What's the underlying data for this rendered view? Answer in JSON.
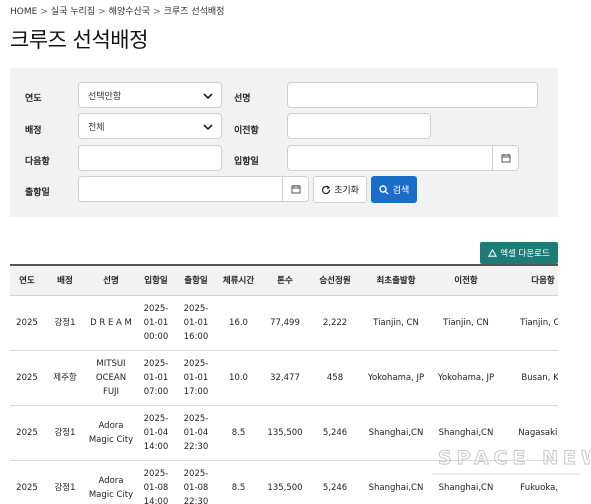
{
  "breadcrumb": [
    "HOME",
    "실국 누리집",
    "해양수산국",
    "크루즈 선석배정"
  ],
  "page_title": "크루즈 선석배정",
  "search": {
    "year_label": "연도",
    "year_value": "선택안함",
    "ship_label": "선명",
    "ship_value": "",
    "berth_label": "배정",
    "berth_value": "전체",
    "prev_port_label": "이전항",
    "prev_port_value": "",
    "next_port_label": "다음항",
    "next_port_value": "",
    "arrival_label": "입항일",
    "arrival_value": "",
    "departure_label": "출항일",
    "departure_value": "",
    "reset_label": "초기화",
    "search_label": "검색"
  },
  "excel_label": "엑셀 다운로드",
  "table": {
    "headers": [
      "연도",
      "배정",
      "선명",
      "입항일",
      "출항일",
      "체류시간",
      "톤수",
      "승선정원",
      "최초출발항",
      "이전항",
      "다음항"
    ],
    "rows": [
      [
        "2025",
        "강정1",
        "D R E A M",
        "2025-01-01 00:00",
        "2025-01-01 16:00",
        "16.0",
        "77,499",
        "2,222",
        "Tianjin, CN",
        "Tianjin, CN",
        "Tianjin, CN"
      ],
      [
        "2025",
        "제주항",
        "MITSUI OCEAN FUJI",
        "2025-01-01 07:00",
        "2025-01-01 17:00",
        "10.0",
        "32,477",
        "458",
        "Yokohama, JP",
        "Yokohama, JP",
        "Busan, KR"
      ],
      [
        "2025",
        "강정1",
        "Adora Magic City",
        "2025-01-04 14:00",
        "2025-01-04 22:30",
        "8.5",
        "135,500",
        "5,246",
        "Shanghai,CN",
        "Shanghai,CN",
        "Nagasaki,JP"
      ],
      [
        "2025",
        "강정1",
        "Adora Magic City",
        "2025-01-08 14:00",
        "2025-01-08 22:30",
        "8.5",
        "135,500",
        "5,246",
        "Shanghai,CN",
        "Shanghai,CN",
        "Fukuoka,JP"
      ]
    ]
  },
  "watermark_text": "SPACE NEWS",
  "colors": {
    "search_button": "#1a6ec9",
    "excel_button": "#1d7b78",
    "panel_bg": "#f2f2f2"
  }
}
